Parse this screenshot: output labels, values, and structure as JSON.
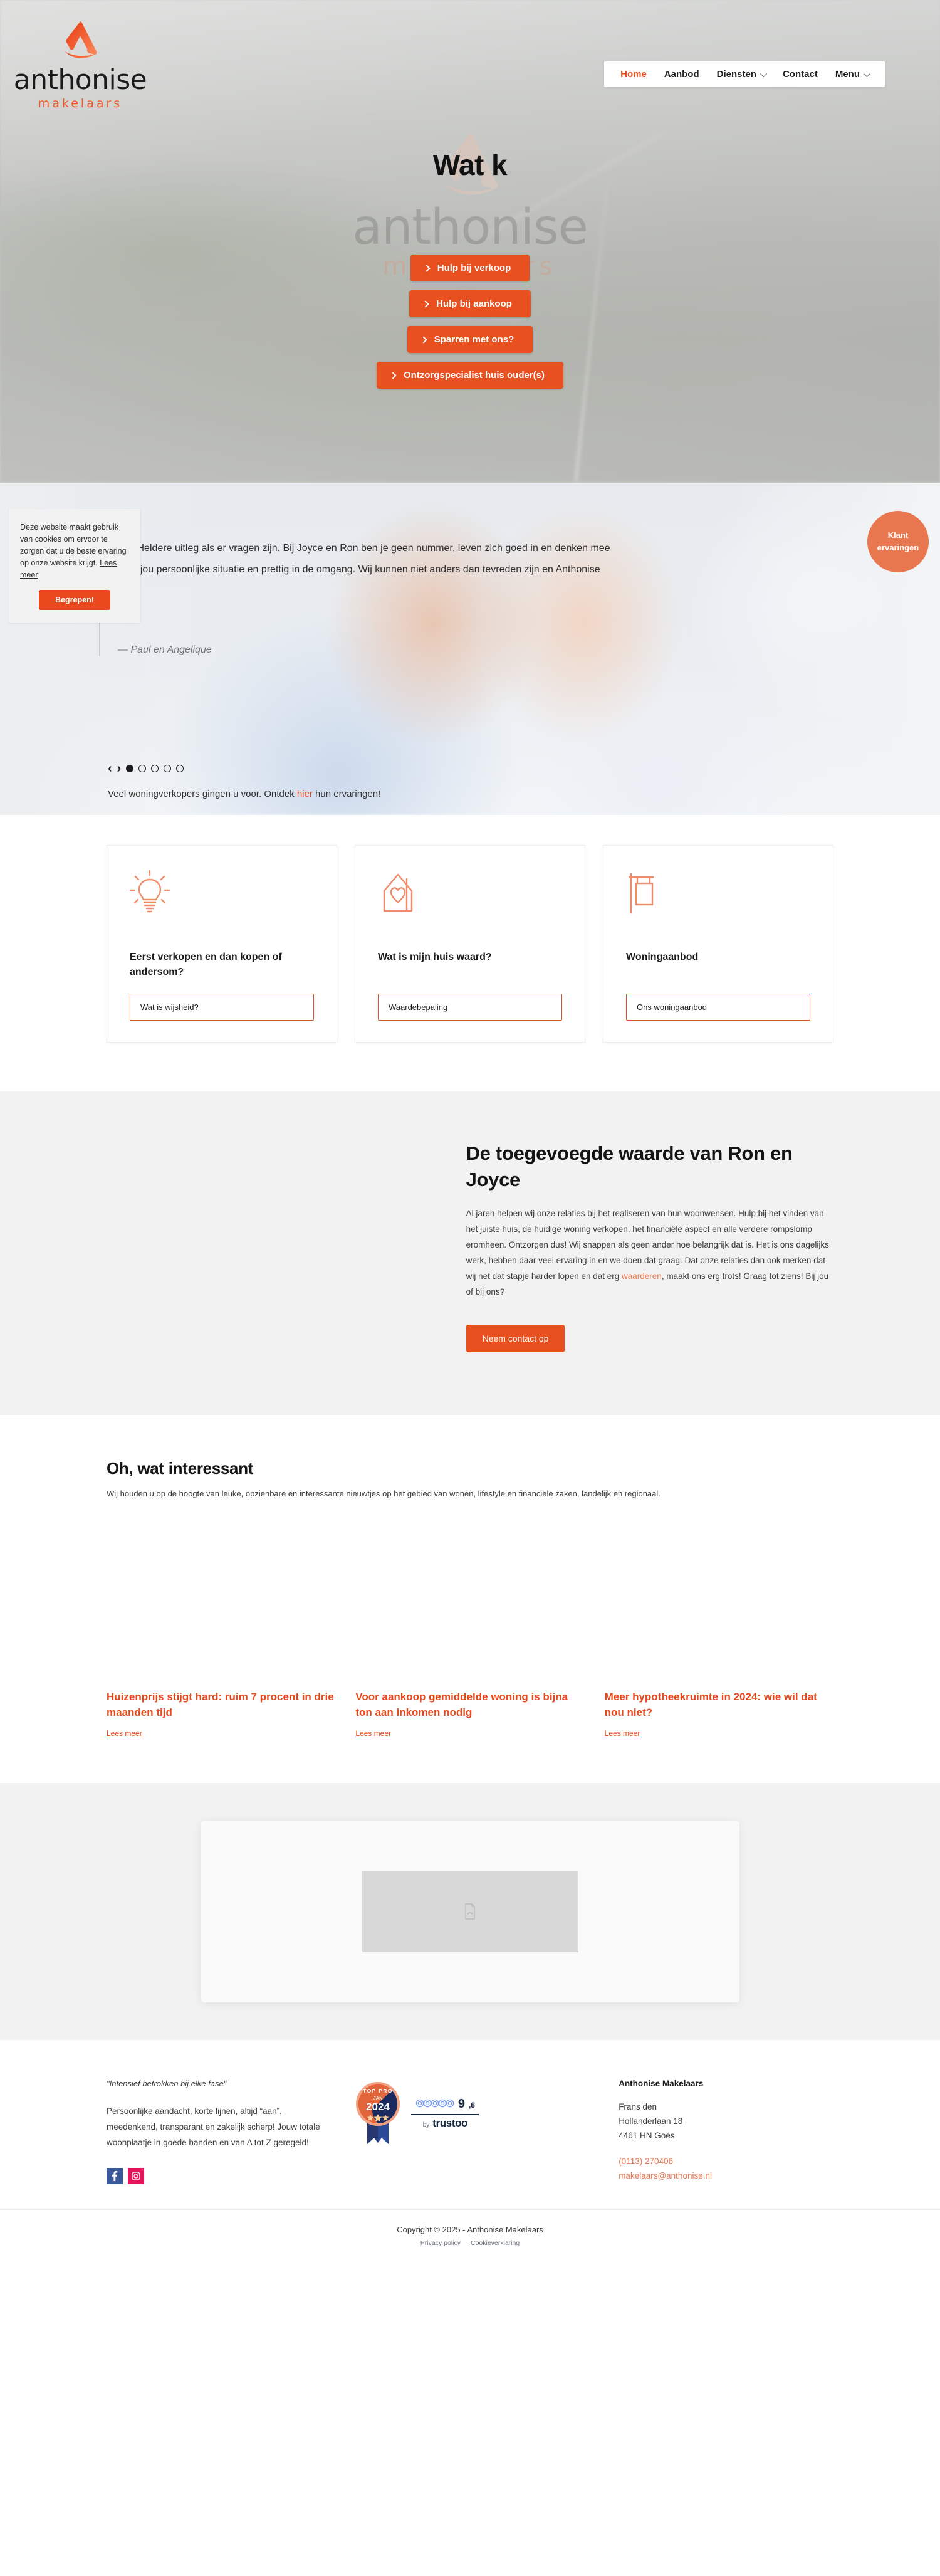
{
  "brand": {
    "name": "anthonise",
    "tagline": "makelaars",
    "accent": "#e8481c",
    "accent_soft": "#e8764f"
  },
  "nav": {
    "items": [
      {
        "label": "Home",
        "active": true,
        "caret": false
      },
      {
        "label": "Aanbod",
        "active": false,
        "caret": false
      },
      {
        "label": "Diensten",
        "active": false,
        "caret": true
      },
      {
        "label": "Contact",
        "active": false,
        "caret": false
      },
      {
        "label": "Menu",
        "active": false,
        "caret": true
      }
    ]
  },
  "hero": {
    "title": "Wat k",
    "buttons": [
      "Hulp bij verkoop",
      "Hulp bij aankoop",
      "Sparren met ons?",
      "Ontzorgspecialist huis ouder(s)"
    ]
  },
  "cookie": {
    "text": "Deze website maakt gebruik van cookies om ervoor te zorgen dat u de beste ervaring op onze website krijgt.",
    "link": "Lees meer",
    "button": "Begrepen!"
  },
  "testimonial": {
    "quote": "eikbaar. Heldere uitleg als er vragen zijn. Bij Joyce en Ron ben je geen nummer, leven zich goed in en denken mee\nericht op jou persoonlijke situatie en prettig in de omgang. Wij kunnen niet anders dan tevreden zijn en Anthonise",
    "quote_line1": "eikbaar. Heldere uitleg als er vragen zijn. Bij Joyce en Ron ben je geen nummer, leven zich goed in en denken mee",
    "quote_line2": "ericht op jou persoonlijke situatie en prettig in de omgang. Wij kunnen niet anders dan tevreden zijn en Anthonise",
    "author": "— Paul en Angelique",
    "dots_total": 5,
    "dots_active_index": 0,
    "footer_pre": "Veel woningverkopers gingen u voor. Ontdek ",
    "footer_link": "hier",
    "footer_post": " hun ervaringen!",
    "side_tab_line1": "Klant",
    "side_tab_line2": "ervaringen"
  },
  "cards": [
    {
      "icon": "lightbulb-icon",
      "title": "Eerst verkopen en dan kopen of andersom?",
      "button": "Wat is wijsheid?"
    },
    {
      "icon": "house-heart-icon",
      "title": "Wat is mijn huis waard?",
      "button": "Waardebepaling"
    },
    {
      "icon": "for-sale-sign-icon",
      "title": "Woningaanbod",
      "button": "Ons woningaanbod"
    }
  ],
  "value": {
    "title": "De toegevoegde waarde van Ron en Joyce",
    "body_part1": "Al jaren helpen wij onze relaties bij het realiseren van hun woonwensen. Hulp bij het vinden van het juiste huis, de huidige woning verkopen, het financiële aspect en alle verdere rompslomp eromheen. Ontzorgen dus! Wij snappen als geen ander hoe belangrijk dat is. Het is ons dagelijks werk, hebben daar veel ervaring in en we doen dat graag. Dat onze relaties dan ook merken dat wij net dat stapje harder lopen en dat erg ",
    "body_link": "waarderen",
    "body_part2": ", maakt ons erg trots! Graag tot ziens! Bij jou of bij ons?",
    "button": "Neem contact op"
  },
  "news": {
    "title": "Oh, wat interessant",
    "subtitle": "Wij houden u op de hoogte van leuke, opzienbare en interessante nieuwtjes op het gebied van wonen, lifestyle en financiële zaken, landelijk en regionaal.",
    "items": [
      {
        "headline": "Huizenprijs stijgt hard: ruim 7 procent in drie maanden tijd",
        "more": "Lees meer"
      },
      {
        "headline": "Voor aankoop gemiddelde woning is bijna ton aan inkomen nodig",
        "more": "Lees meer"
      },
      {
        "headline": "Meer hypotheekruimte in 2024: wie wil dat nou niet?",
        "more": "Lees meer"
      }
    ]
  },
  "footer": {
    "quote": "\"Intensief betrokken bij elke fase\"",
    "body": "Persoonlijke aandacht, korte lijnen, altijd “aan”, meedenkend, transparant en zakelijk scherp! Jouw totale woonplaatje in goede handen en van A tot Z geregeld!",
    "socials": [
      {
        "name": "facebook-icon",
        "glyph": "f",
        "color": "#3b5998"
      },
      {
        "name": "instagram-icon",
        "glyph": "◎",
        "color": "#e4175c"
      }
    ],
    "badge": {
      "top_text": "TOP PRO",
      "month": "JAN",
      "year": "2024",
      "stars": 3
    },
    "trustoo": {
      "score": "9",
      "decimal": ",8",
      "stars": 5,
      "by": "by",
      "brand": "trustoo"
    },
    "company": "Anthonise Makelaars",
    "address_line1": "Frans den",
    "address_line2": "Hollanderlaan 18",
    "address_line3": "4461 HN Goes",
    "phone": "(0113) 270406",
    "email": "makelaars@anthonise.nl"
  },
  "copyright": {
    "line": "Copyright © 2025 - Anthonise Makelaars",
    "links": [
      "Privacy policy",
      "Cookieverklaring"
    ]
  }
}
